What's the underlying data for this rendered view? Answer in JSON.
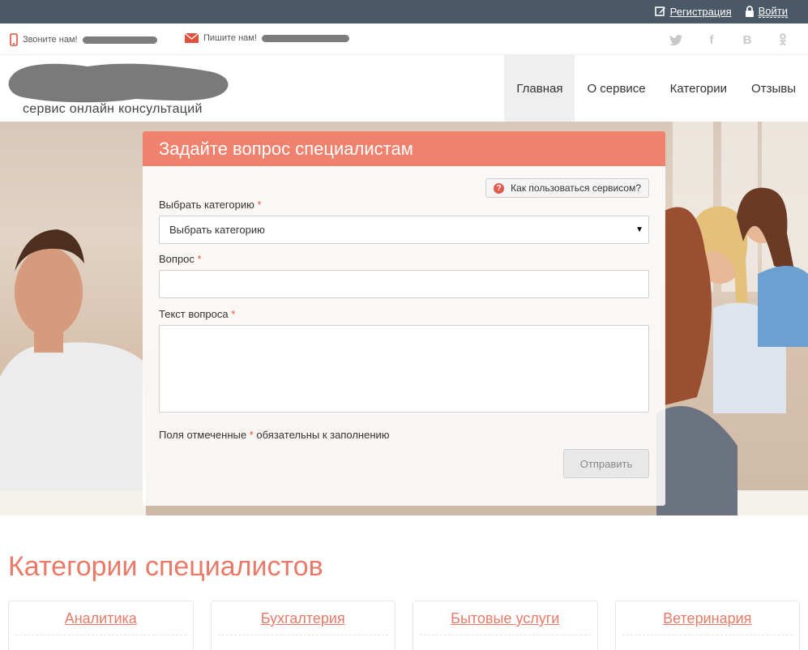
{
  "topbar": {
    "register_label": "Регистрация",
    "login_label": "Войти"
  },
  "contacts": {
    "phone_label": "Звоните нам!",
    "mail_label": "Пишите нам!"
  },
  "social": {
    "twitter": "twitter-icon",
    "facebook": "f",
    "vk": "B",
    "ok": "odnoklassniki-icon"
  },
  "header": {
    "tagline": "сервис онлайн консультаций",
    "nav": [
      {
        "label": "Главная",
        "active": true
      },
      {
        "label": "О сервисе"
      },
      {
        "label": "Категории"
      },
      {
        "label": "Отзывы"
      }
    ]
  },
  "form": {
    "title": "Задайте вопрос специалистам",
    "help_label": "Как пользоваться сервисом?",
    "help_icon": "?",
    "category_label": "Выбрать категорию",
    "category_selected": "Выбрать категорию",
    "question_label": "Вопрос",
    "question_value": "",
    "text_label": "Текст вопроса",
    "text_value": "",
    "required_mark": "*",
    "note_before": "Поля отмеченные",
    "note_after": "обязательны к заполнению",
    "submit_label": "Отправить"
  },
  "categories": {
    "title": "Категории специалистов",
    "items": [
      "Аналитика",
      "Бухгалтерия",
      "Бытовые услуги",
      "Ветеринария"
    ]
  },
  "colors": {
    "topbar_bg": "#4a5867",
    "accent": "#f0816d",
    "category_text": "#ea7a68"
  }
}
